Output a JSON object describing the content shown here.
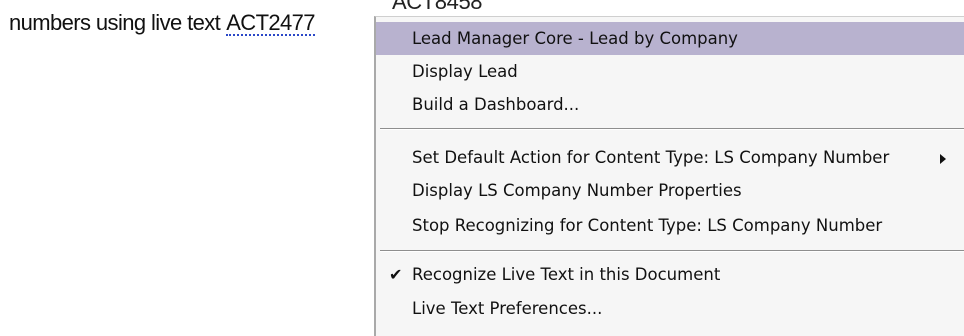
{
  "document": {
    "prefix_text": "numbers using live text",
    "live_text_value": "ACT2477",
    "behind_text": "ACT8458\""
  },
  "context_menu": {
    "items": [
      {
        "label": "Lead Manager Core - Lead by Company",
        "highlighted": true
      },
      {
        "label": "Display Lead"
      },
      {
        "label": "Build a Dashboard..."
      },
      {
        "label": "Set Default Action for Content Type: LS Company Number",
        "has_submenu": true
      },
      {
        "label": "Display LS Company Number Properties"
      },
      {
        "label": "Stop Recognizing for Content Type: LS Company Number"
      },
      {
        "label": "Recognize Live Text in this Document",
        "checked": true
      },
      {
        "label": "Live Text Preferences..."
      }
    ],
    "highlight_color": "#b8b2cf",
    "check_icon": "checkmark-icon",
    "submenu_icon": "triangle-right-icon"
  }
}
